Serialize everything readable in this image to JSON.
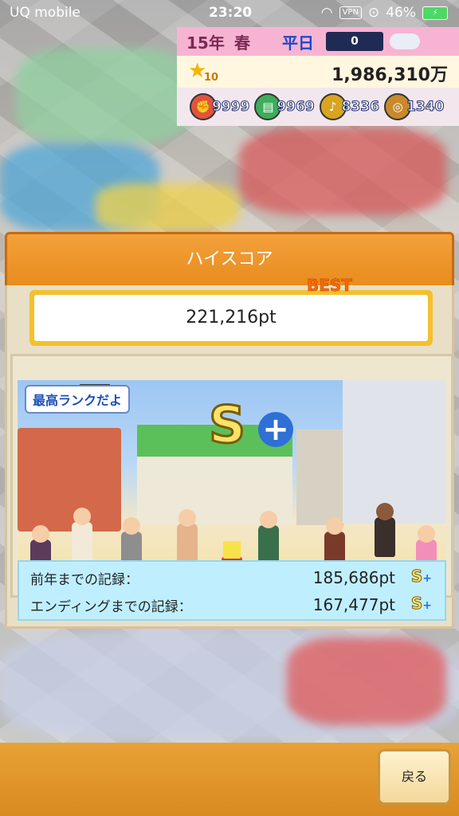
{
  "status_bar": {
    "carrier": "UQ mobile",
    "time": "23:20",
    "vpn": "VPN",
    "battery": "46%"
  },
  "hud": {
    "year": "15年",
    "season": "春",
    "day_type": "平日",
    "weather_value": "0",
    "star_level": "10",
    "money": "1,986,310万",
    "stats": [
      {
        "icon": "muscle-icon",
        "value": "9999",
        "color": "#e0543c"
      },
      {
        "icon": "book-icon",
        "value": "9969",
        "color": "#3cae5a"
      },
      {
        "icon": "music-icon",
        "value": "8336",
        "color": "#d9a520"
      },
      {
        "icon": "coin-icon",
        "value": "1340",
        "color": "#c88a2a"
      }
    ]
  },
  "dialog": {
    "title": "ハイスコア",
    "score": "221,216pt",
    "best_label": "BEST",
    "badge": "最高ランクだよ",
    "rank": "S",
    "rank_plus": "+",
    "records": [
      {
        "label": "前年までの記録：",
        "value": "185,686pt",
        "rank": "S",
        "plus": "+"
      },
      {
        "label": "エンディングまでの記録：",
        "value": "167,477pt",
        "rank": "S",
        "plus": "+"
      }
    ]
  },
  "buttons": {
    "back": "戻る"
  }
}
